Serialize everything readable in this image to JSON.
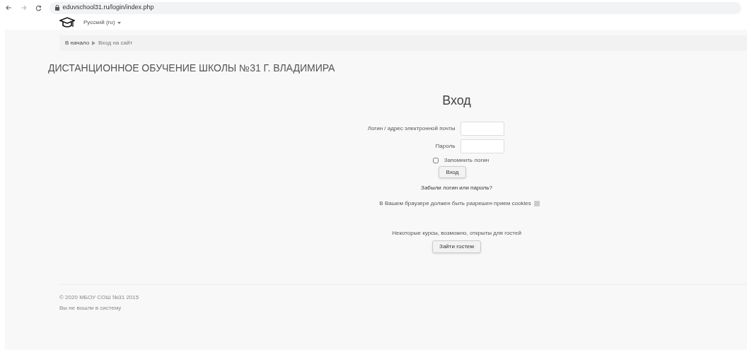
{
  "browser": {
    "url": "eduvschool31.ru/login/index.php"
  },
  "header": {
    "language": "Русский (ru)"
  },
  "breadcrumb": [
    "В начало",
    "Вход на сайт"
  ],
  "site_title": "ДИСТАНЦИОННОЕ ОБУЧЕНИЕ ШКОЛЫ №31 Г. ВЛАДИМИРА",
  "login": {
    "heading": "Вход",
    "fields": [
      {
        "label": "Логин / адрес электронной почты"
      },
      {
        "label": "Пароль"
      }
    ],
    "remember": {
      "label": "Запомнить логин",
      "checked": false
    },
    "submit": "Вход",
    "forgot": "Забыли логин или пароль?",
    "cookies": "В Вашем браузере должен быть разрешен прием cookies",
    "guest_note": "Некоторые курсы, возможно, открыты для гостей",
    "guest_button": "Зайти гостем"
  },
  "footer": [
    "© 2020 МБОУ СОШ №31 2015",
    "Вы не вошли в систему"
  ]
}
